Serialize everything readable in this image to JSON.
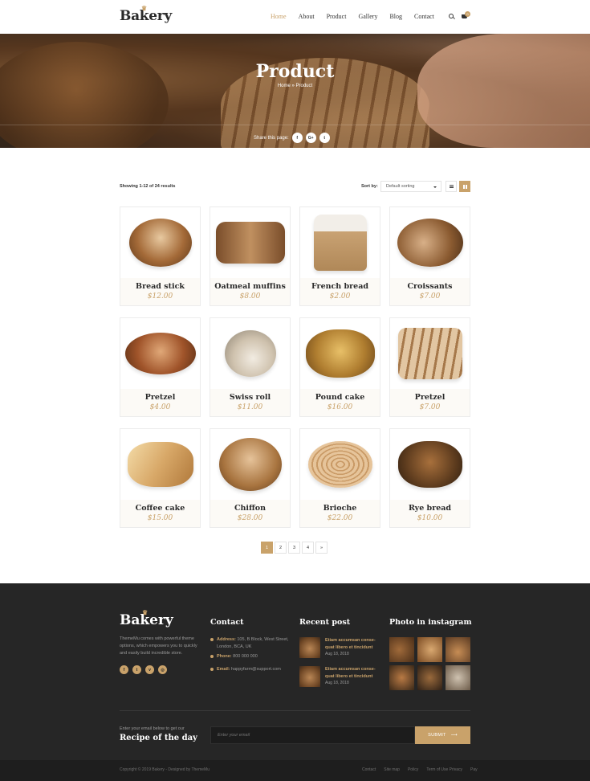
{
  "header": {
    "logo": "Bakery",
    "nav": [
      "Home",
      "About",
      "Product",
      "Gallery",
      "Blog",
      "Contact"
    ],
    "cart_count": "0"
  },
  "hero": {
    "title": "Product",
    "breadcrumb": "Home  »  Product",
    "share_label": "Share this page:",
    "share_buttons": [
      "f",
      "G+",
      "t"
    ]
  },
  "toolbar": {
    "showing": "Showing 1-12 of 24 results",
    "sort_label": "Sort by:",
    "sort_value": "Default sorting"
  },
  "products": [
    {
      "name": "Bread stick",
      "price": "$12.00"
    },
    {
      "name": "Oatmeal muffins",
      "price": "$8.00"
    },
    {
      "name": "French bread",
      "price": "$2.00"
    },
    {
      "name": "Croissants",
      "price": "$7.00"
    },
    {
      "name": "Pretzel",
      "price": "$4.00"
    },
    {
      "name": "Swiss roll",
      "price": "$11.00"
    },
    {
      "name": "Pound cake",
      "price": "$16.00"
    },
    {
      "name": "Pretzel",
      "price": "$7.00"
    },
    {
      "name": "Coffee cake",
      "price": "$15.00"
    },
    {
      "name": "Chiffon",
      "price": "$28.00"
    },
    {
      "name": "Brioche",
      "price": "$22.00"
    },
    {
      "name": "Rye bread",
      "price": "$10.00"
    }
  ],
  "pagination": [
    "1",
    "2",
    "3",
    "4",
    "»"
  ],
  "footer": {
    "logo": "Bakery",
    "about": "ThemeMu comes with powerful theme options, which empowers you to quickly and easily build incredible store.",
    "social": [
      "f",
      "t",
      "v",
      "◎"
    ],
    "contact_heading": "Contact",
    "address_label": "Address:",
    "address": "105, B Block, West Street, London, BCA, UK",
    "phone_label": "Phone:",
    "phone": "800 000 000",
    "email_label": "Email:",
    "email": "happyfarm@support.com",
    "recent_heading": "Recent post",
    "posts": [
      {
        "title": "Etiam accumsan conse-quat libero et tincidunt",
        "date": "Aug 18, 2018"
      },
      {
        "title": "Etiam accumsan conse-quat libero et tincidunt",
        "date": "Aug 18, 2018"
      }
    ],
    "instagram_heading": "Photo in instagram",
    "newsletter_small": "Enter your email below to get our",
    "newsletter_big": "Recipe of the day",
    "email_placeholder": "Enter your email",
    "submit_label": "SUBMIT",
    "copyright": "Copyright © 2019 Bakery - Designed by ThemeMu",
    "links": [
      "Contact",
      "Site map",
      "Policy",
      "Term of Use Privacy",
      "Pay"
    ]
  },
  "colors": {
    "accent": "#c9a26a",
    "dark": "#262626"
  }
}
